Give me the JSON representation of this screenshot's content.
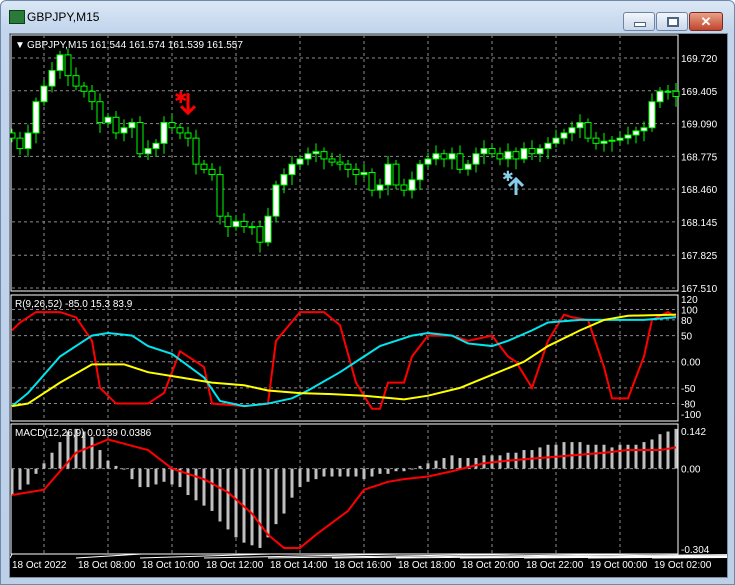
{
  "window": {
    "title": "GBPJPY,M15",
    "buttons": [
      "minimize",
      "maximize",
      "close"
    ]
  },
  "chart_data": [
    {
      "type": "candlestick",
      "title": "GBPJPY,M15",
      "ohlc_label": "161.544 161.574 161.539 161.557",
      "y_ticks": [
        "169.720",
        "169.405",
        "169.090",
        "168.775",
        "168.460",
        "168.145",
        "167.825",
        "167.510"
      ],
      "ylim": [
        167.51,
        169.72
      ],
      "grid": true,
      "colors": {
        "bull": "#ffffff",
        "bear": "#000000",
        "wick": "#00ff00"
      },
      "close": [
        168.95,
        168.85,
        169.0,
        169.3,
        169.45,
        169.6,
        169.75,
        169.55,
        169.45,
        169.4,
        169.3,
        169.1,
        169.15,
        169.0,
        169.05,
        169.1,
        168.8,
        168.85,
        168.9,
        169.1,
        169.05,
        169.0,
        168.95,
        168.7,
        168.65,
        168.6,
        168.2,
        168.1,
        168.15,
        168.1,
        168.1,
        167.95,
        168.2,
        168.5,
        168.6,
        168.7,
        168.75,
        168.8,
        168.82,
        168.75,
        168.72,
        168.7,
        168.65,
        168.6,
        168.62,
        168.45,
        168.5,
        168.7,
        168.5,
        168.45,
        168.55,
        168.7,
        168.75,
        168.8,
        168.75,
        168.8,
        168.65,
        168.7,
        168.8,
        168.85,
        168.8,
        168.75,
        168.82,
        168.75,
        168.85,
        168.8,
        168.85,
        168.9,
        168.95,
        169.0,
        169.05,
        169.1,
        168.95,
        168.9,
        168.92,
        168.93,
        168.95,
        168.98,
        169.02,
        169.05,
        169.3,
        169.4,
        169.4,
        169.35
      ],
      "signals": [
        {
          "type": "sell",
          "candle": 22,
          "color": "#ff0000"
        },
        {
          "type": "buy",
          "candle": 63,
          "color": "#87ceeb"
        }
      ]
    },
    {
      "type": "line",
      "title": "R(9,26,52) -85.0 15.3 83.9",
      "y_ticks": [
        "120",
        "100",
        "80",
        "50",
        "0.00",
        "-50",
        "-80",
        "-100"
      ],
      "ylim": [
        -100,
        120
      ],
      "series": [
        {
          "color": "#ff0000",
          "points": [
            [
              0,
              60
            ],
            [
              1,
              75
            ],
            [
              3,
              95
            ],
            [
              6,
              95
            ],
            [
              8,
              85
            ],
            [
              10,
              40
            ],
            [
              11,
              -50
            ],
            [
              13,
              -80
            ],
            [
              17,
              -80
            ],
            [
              19,
              -60
            ],
            [
              21,
              20
            ],
            [
              24,
              -10
            ],
            [
              25,
              -80
            ],
            [
              29,
              -85
            ],
            [
              32,
              -80
            ],
            [
              33,
              40
            ],
            [
              36,
              95
            ],
            [
              39,
              95
            ],
            [
              41,
              70
            ],
            [
              43,
              -40
            ],
            [
              45,
              -90
            ],
            [
              46,
              -90
            ],
            [
              47,
              -40
            ],
            [
              49,
              -40
            ],
            [
              50,
              10
            ],
            [
              52,
              50
            ],
            [
              55,
              50
            ],
            [
              57,
              40
            ],
            [
              60,
              50
            ],
            [
              62,
              10
            ],
            [
              63,
              0
            ],
            [
              65,
              -50
            ],
            [
              67,
              40
            ],
            [
              69,
              90
            ],
            [
              70,
              85
            ],
            [
              72,
              80
            ],
            [
              74,
              -10
            ],
            [
              75,
              -70
            ],
            [
              77,
              -70
            ],
            [
              79,
              10
            ],
            [
              80,
              80
            ],
            [
              82,
              95
            ],
            [
              83,
              85
            ]
          ]
        },
        {
          "color": "#00e5ee",
          "points": [
            [
              0,
              -85
            ],
            [
              2,
              -60
            ],
            [
              6,
              10
            ],
            [
              10,
              50
            ],
            [
              12,
              55
            ],
            [
              15,
              50
            ],
            [
              17,
              30
            ],
            [
              20,
              15
            ],
            [
              24,
              -30
            ],
            [
              26,
              -75
            ],
            [
              29,
              -85
            ],
            [
              32,
              -80
            ],
            [
              35,
              -70
            ],
            [
              37,
              -55
            ],
            [
              41,
              -20
            ],
            [
              44,
              10
            ],
            [
              46,
              30
            ],
            [
              48,
              40
            ],
            [
              50,
              50
            ],
            [
              52,
              55
            ],
            [
              55,
              50
            ],
            [
              57,
              35
            ],
            [
              60,
              30
            ],
            [
              62,
              40
            ],
            [
              65,
              60
            ],
            [
              67,
              75
            ],
            [
              71,
              80
            ],
            [
              75,
              80
            ],
            [
              79,
              80
            ],
            [
              83,
              85
            ]
          ]
        },
        {
          "color": "#ffff00",
          "points": [
            [
              0,
              -85
            ],
            [
              2,
              -80
            ],
            [
              6,
              -40
            ],
            [
              10,
              -5
            ],
            [
              14,
              -5
            ],
            [
              17,
              -20
            ],
            [
              21,
              -30
            ],
            [
              25,
              -40
            ],
            [
              29,
              -45
            ],
            [
              32,
              -55
            ],
            [
              36,
              -60
            ],
            [
              40,
              -62
            ],
            [
              44,
              -65
            ],
            [
              49,
              -72
            ],
            [
              52,
              -65
            ],
            [
              56,
              -50
            ],
            [
              60,
              -25
            ],
            [
              64,
              0
            ],
            [
              67,
              30
            ],
            [
              71,
              60
            ],
            [
              74,
              80
            ],
            [
              77,
              88
            ],
            [
              83,
              90
            ]
          ]
        }
      ]
    },
    {
      "type": "bar",
      "title": "MACD(12,26,9) 0.0139 0.0386",
      "y_ticks": [
        "0.142",
        "0.00",
        "-0.304"
      ],
      "ylim": [
        -0.304,
        0.142
      ],
      "histogram_color": "#c0c0c0",
      "histogram": [
        -0.1,
        -0.08,
        -0.06,
        -0.02,
        0.02,
        0.06,
        0.1,
        0.14,
        0.15,
        0.14,
        0.12,
        0.07,
        0.03,
        0.01,
        0.0,
        -0.04,
        -0.07,
        -0.07,
        -0.06,
        -0.05,
        -0.06,
        -0.07,
        -0.1,
        -0.12,
        -0.14,
        -0.16,
        -0.2,
        -0.23,
        -0.26,
        -0.28,
        -0.29,
        -0.3,
        -0.26,
        -0.21,
        -0.17,
        -0.11,
        -0.07,
        -0.05,
        -0.04,
        -0.03,
        -0.03,
        -0.03,
        -0.03,
        -0.03,
        -0.04,
        -0.03,
        -0.02,
        -0.02,
        -0.01,
        -0.01,
        0.0,
        0.01,
        0.02,
        0.03,
        0.04,
        0.05,
        0.04,
        0.04,
        0.04,
        0.05,
        0.05,
        0.05,
        0.06,
        0.06,
        0.07,
        0.07,
        0.08,
        0.09,
        0.09,
        0.1,
        0.1,
        0.1,
        0.09,
        0.09,
        0.09,
        0.08,
        0.09,
        0.09,
        0.09,
        0.1,
        0.11,
        0.13,
        0.14,
        0.15
      ],
      "signal": {
        "color": "#ff0000",
        "points": [
          [
            0,
            -0.1
          ],
          [
            4,
            -0.08
          ],
          [
            8,
            0.06
          ],
          [
            12,
            0.11
          ],
          [
            17,
            0.07
          ],
          [
            20,
            0.0
          ],
          [
            24,
            -0.04
          ],
          [
            27,
            -0.09
          ],
          [
            30,
            -0.17
          ],
          [
            32,
            -0.25
          ],
          [
            34,
            -0.3
          ],
          [
            36,
            -0.3
          ],
          [
            38,
            -0.25
          ],
          [
            42,
            -0.16
          ],
          [
            44,
            -0.08
          ],
          [
            47,
            -0.05
          ],
          [
            49,
            -0.04
          ],
          [
            52,
            -0.03
          ],
          [
            55,
            -0.01
          ],
          [
            59,
            0.02
          ],
          [
            62,
            0.03
          ],
          [
            66,
            0.04
          ],
          [
            70,
            0.05
          ],
          [
            74,
            0.06
          ],
          [
            77,
            0.07
          ],
          [
            81,
            0.07
          ],
          [
            83,
            0.08
          ]
        ]
      }
    }
  ],
  "time_axis": [
    "18 Oct 2022",
    "18 Oct 08:00",
    "18 Oct 10:00",
    "18 Oct 12:00",
    "18 Oct 14:00",
    "18 Oct 16:00",
    "18 Oct 18:00",
    "18 Oct 20:00",
    "18 Oct 22:00",
    "19 Oct 00:00",
    "19 Oct 02:00"
  ]
}
